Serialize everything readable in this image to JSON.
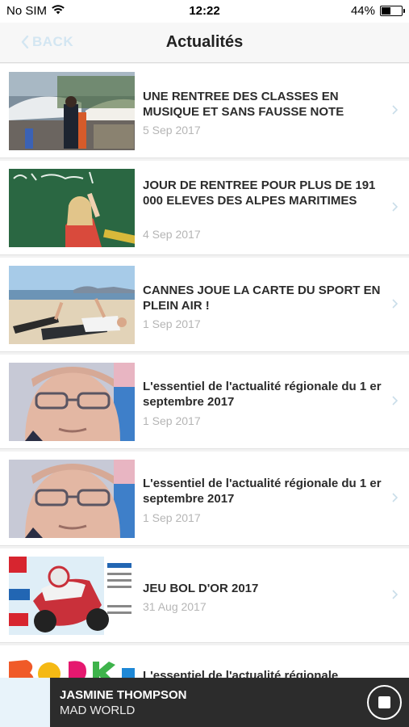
{
  "status_bar": {
    "carrier": "No SIM",
    "time": "12:22",
    "battery_percent": "44%",
    "battery_level": 0.44
  },
  "nav": {
    "back_label": "BACK",
    "title": "Actualités"
  },
  "news": [
    {
      "title": "UNE RENTREE DES CLASSES EN MUSIQUE ET SANS FAUSSE NOTE",
      "date": "5 Sep 2017",
      "thumb": "stage-performer"
    },
    {
      "title": "JOUR DE RENTREE POUR PLUS DE 191 000 ELEVES DES ALPES MARITIMES",
      "date": "4 Sep 2017",
      "thumb": "child-chalkboard"
    },
    {
      "title": "CANNES JOUE LA CARTE DU SPORT EN PLEIN AIR !",
      "date": "1 Sep 2017",
      "thumb": "beach-exercise"
    },
    {
      "title": "L'essentiel de l'actualité régionale du 1 er septembre 2017",
      "date": "1 Sep 2017",
      "thumb": "man-portrait"
    },
    {
      "title": "L'essentiel de l'actualité régionale du 1 er septembre 2017",
      "date": "1 Sep 2017",
      "thumb": "man-portrait"
    },
    {
      "title": "JEU BOL D'OR 2017",
      "date": "31 Aug 2017",
      "thumb": "motorbike-race"
    },
    {
      "title": "L'essentiel de l'actualité régionale",
      "date": "",
      "thumb": "back-to-school-letters"
    }
  ],
  "player": {
    "artist": "JASMINE THOMPSON",
    "track": "MAD WORLD"
  },
  "colors": {
    "accent_light": "#d3e6f2",
    "player_bg": "#2c2c2c",
    "date_gray": "#b5b5b5"
  }
}
